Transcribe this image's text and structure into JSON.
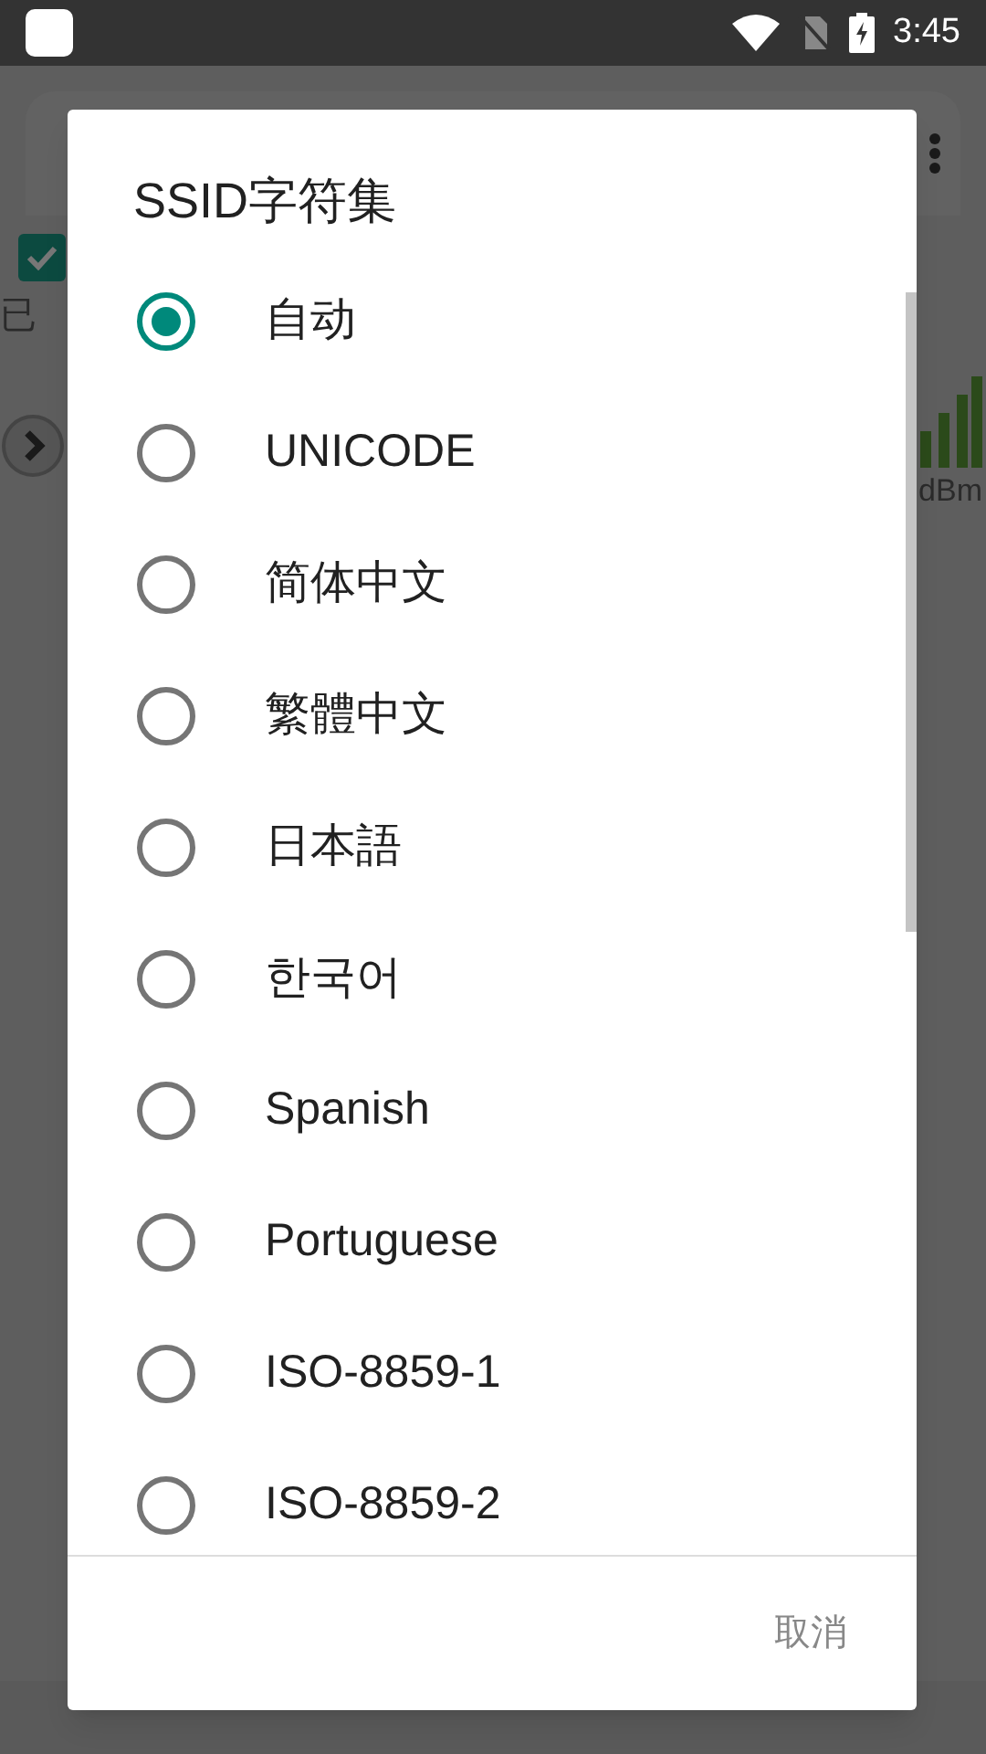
{
  "status_bar": {
    "time": "3:45"
  },
  "background_app": {
    "checkbox_checked": true,
    "status_text": "已",
    "signal_unit": "dBm"
  },
  "dialog": {
    "title": "SSID字符集",
    "options": [
      {
        "label": "自动",
        "selected": true
      },
      {
        "label": "UNICODE",
        "selected": false
      },
      {
        "label": "简体中文",
        "selected": false
      },
      {
        "label": "繁體中文",
        "selected": false
      },
      {
        "label": "日本語",
        "selected": false
      },
      {
        "label": "한국어",
        "selected": false
      },
      {
        "label": "Spanish",
        "selected": false
      },
      {
        "label": "Portuguese",
        "selected": false
      },
      {
        "label": "ISO-8859-1",
        "selected": false
      },
      {
        "label": "ISO-8859-2",
        "selected": false
      }
    ],
    "cancel_button": "取消"
  }
}
